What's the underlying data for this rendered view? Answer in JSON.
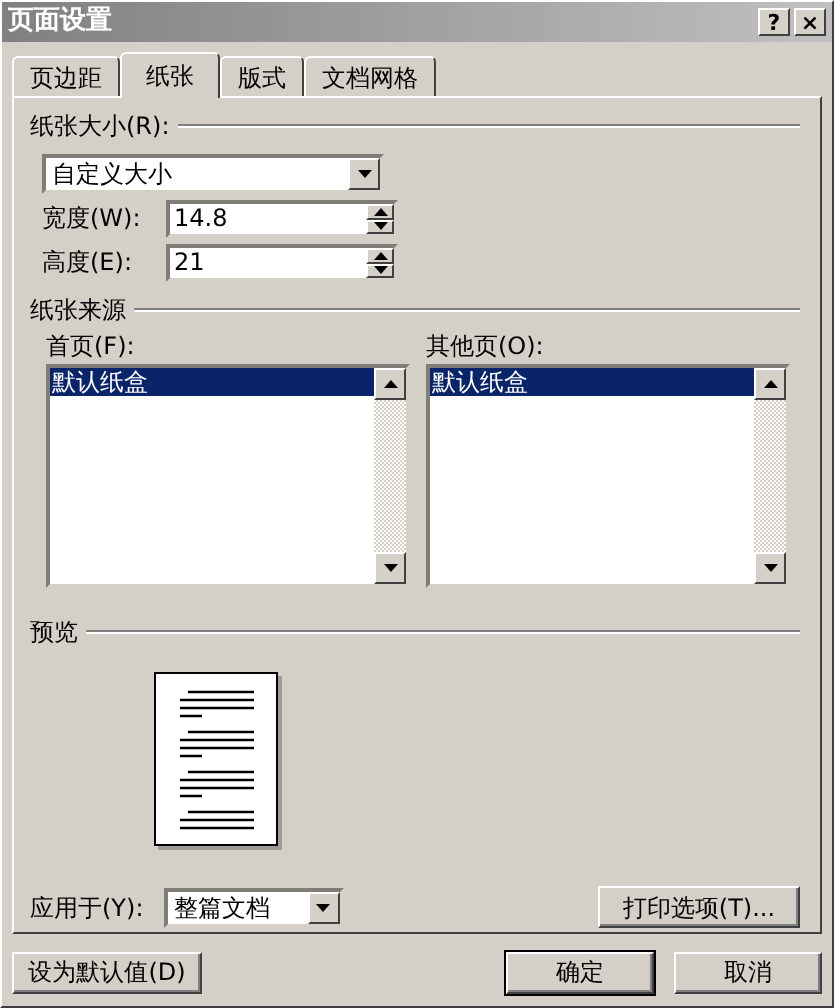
{
  "window": {
    "title": "页面设置",
    "help_button": "?",
    "close_button": "×"
  },
  "tabs": [
    {
      "label": "页边距",
      "selected": false
    },
    {
      "label": "纸张",
      "selected": true
    },
    {
      "label": "版式",
      "selected": false
    },
    {
      "label": "文档网格",
      "selected": false
    }
  ],
  "paper_size": {
    "heading": "纸张大小(R):",
    "dropdown_value": "自定义大小",
    "fields": [
      {
        "label": "宽度(W):",
        "value": "14.8"
      },
      {
        "label": "高度(E):",
        "value": "21"
      }
    ]
  },
  "paper_source": {
    "heading": "纸张来源",
    "lists": [
      {
        "label": "首页(F):",
        "items": [
          {
            "text": "默认纸盒",
            "selected": true
          }
        ]
      },
      {
        "label": "其他页(O):",
        "items": [
          {
            "text": "默认纸盒",
            "selected": true
          }
        ]
      }
    ]
  },
  "preview": {
    "heading": "预览"
  },
  "apply_to": {
    "label": "应用于(Y):",
    "value": "整篇文档"
  },
  "print_options_button": "打印选项(T)...",
  "buttons": [
    {
      "label": "设为默认值(D)",
      "default": false
    },
    {
      "label": "确定",
      "default": true
    },
    {
      "label": "取消",
      "default": false
    }
  ]
}
